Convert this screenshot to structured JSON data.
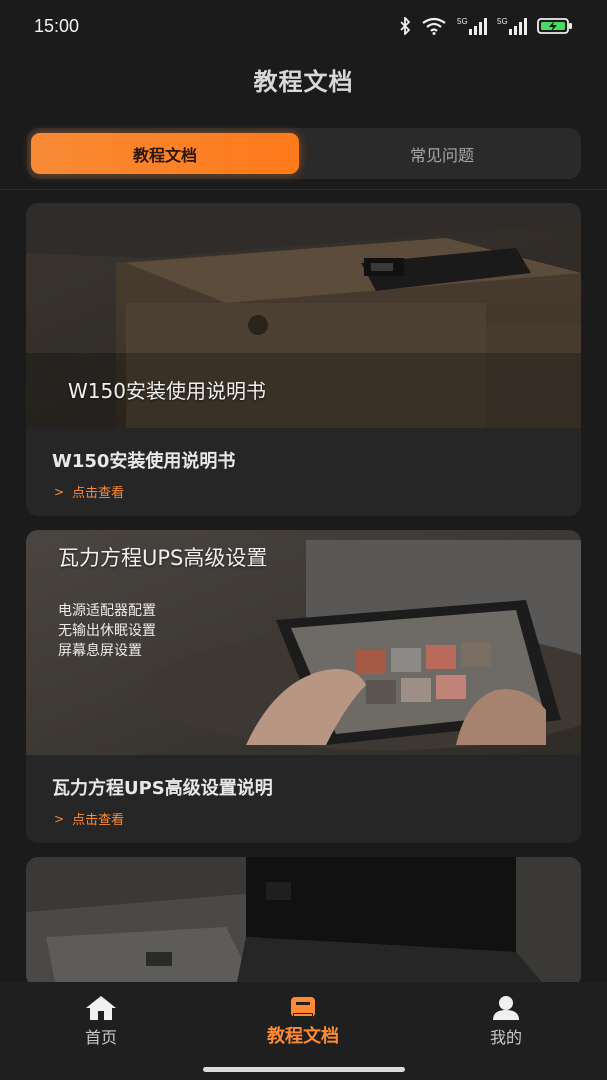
{
  "status_bar": {
    "time": "15:00",
    "icons": [
      "bluetooth-icon",
      "wifi-icon",
      "signal-5g-icon",
      "signal-5g-icon",
      "battery-charging-icon"
    ],
    "network_label_1": "5G",
    "network_label_2": "5G"
  },
  "header": {
    "title": "教程文档"
  },
  "tabs": [
    {
      "label": "教程文档",
      "active": true
    },
    {
      "label": "常见问题",
      "active": false
    }
  ],
  "cards": [
    {
      "image_caption": "W150安装使用说明书",
      "title": "W150安装使用说明书",
      "link_label": "点击查看"
    },
    {
      "image_caption": "瓦力方程UPS高级设置",
      "image_lines": [
        "电源适配器配置",
        "无输出休眠设置",
        "屏幕息屏设置"
      ],
      "title": "瓦力方程UPS高级设置说明",
      "link_label": "点击查看"
    },
    {
      "image_caption": "",
      "title": "",
      "link_label": ""
    }
  ],
  "bottom_nav": [
    {
      "label": "首页",
      "icon": "home-icon",
      "active": false
    },
    {
      "label": "教程文档",
      "icon": "book-icon",
      "active": true
    },
    {
      "label": "我的",
      "icon": "user-icon",
      "active": false
    }
  ],
  "colors": {
    "accent": "#ff8a33",
    "background": "#1b1b1b",
    "card": "#262626"
  }
}
